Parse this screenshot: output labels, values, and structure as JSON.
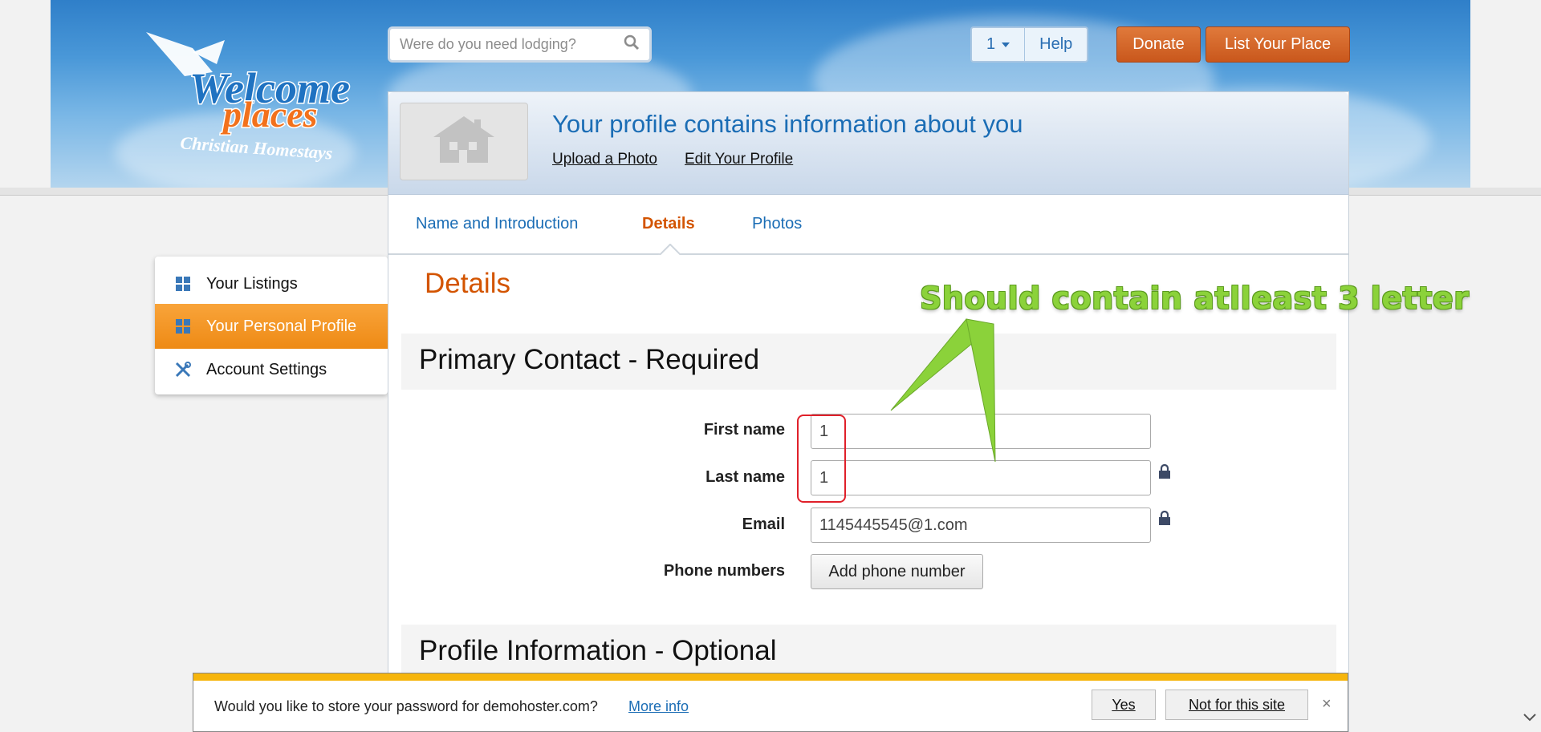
{
  "header": {
    "logo": {
      "line1": "Welcome",
      "line2": "places",
      "tagline": "Christian Homestays"
    },
    "search": {
      "placeholder": "Were do you need lodging?",
      "icon": "search-icon"
    },
    "user_menu": {
      "label": "1",
      "icon": "caret-down-icon"
    },
    "help_label": "Help",
    "donate_label": "Donate",
    "list_place_label": "List Your Place"
  },
  "profile": {
    "title": "Your profile contains information about you",
    "upload_photo": "Upload a Photo",
    "edit_profile": "Edit Your Profile",
    "photo_icon": "house-icon"
  },
  "tabs": [
    {
      "label": "Name and Introduction",
      "active": false
    },
    {
      "label": "Details",
      "active": true
    },
    {
      "label": "Photos",
      "active": false
    }
  ],
  "sidebar": {
    "items": [
      {
        "label": "Your Listings",
        "icon": "grid-icon",
        "active": false
      },
      {
        "label": "Your Personal Profile",
        "icon": "grid-icon",
        "active": true
      },
      {
        "label": "Account Settings",
        "icon": "tools-icon",
        "active": false
      }
    ]
  },
  "details": {
    "title": "Details",
    "primary_section": "Primary Contact - Required",
    "fields": {
      "first_name": {
        "label": "First name",
        "value": "1"
      },
      "last_name": {
        "label": "Last name",
        "value": "1"
      },
      "email": {
        "label": "Email",
        "value": "1145445545@1.com"
      },
      "phone": {
        "label": "Phone numbers",
        "button": "Add phone number"
      }
    },
    "optional_section": "Profile Information - Optional"
  },
  "annotation": {
    "text": "Should contain atlleast 3 letter",
    "color": "#8bd23a"
  },
  "password_bar": {
    "message": "Would you like to store your password for demohoster.com?",
    "more_info": "More info",
    "yes": "Yes",
    "not_for_site": "Not for this site",
    "close": "×"
  },
  "colors": {
    "accent_orange": "#d35400",
    "link_blue": "#1b6db5",
    "sidebar_active": "#ee8a15",
    "warning_stripe": "#f6b50c"
  }
}
